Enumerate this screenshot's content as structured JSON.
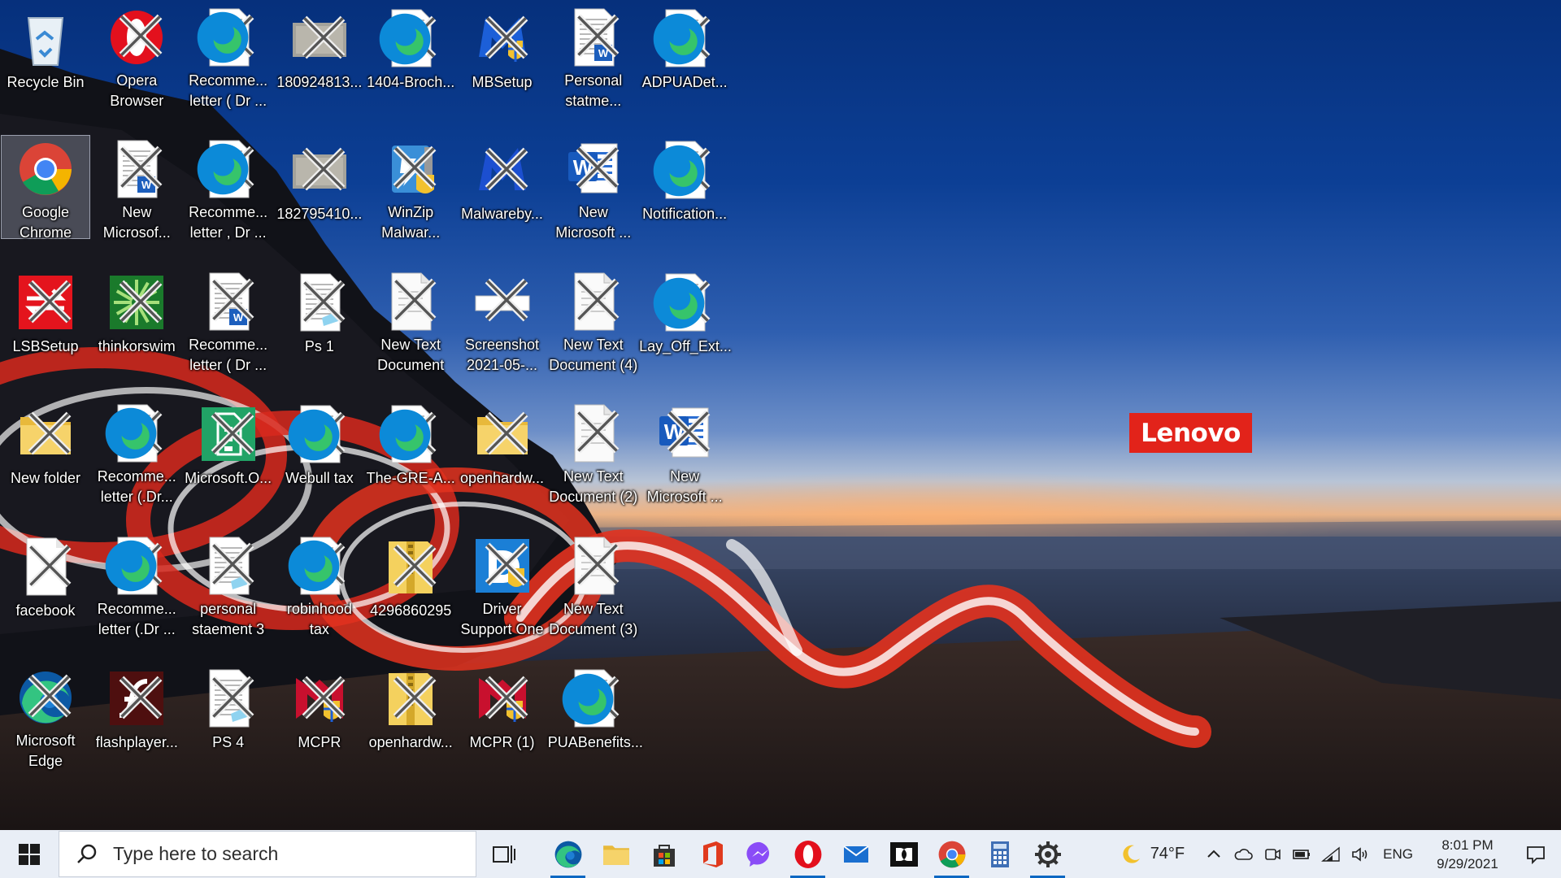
{
  "desktop": {
    "icons": [
      {
        "label": "Recycle Bin",
        "icon": "recycle-bin-icon"
      },
      {
        "label": "Opera\nBrowser",
        "icon": "opera-icon"
      },
      {
        "label": "Recomme...\nletter ( Dr ...",
        "icon": "edge-document-icon"
      },
      {
        "label": "180924813...",
        "icon": "image-thumbnail-icon"
      },
      {
        "label": "1404-Broch...",
        "icon": "edge-document-icon"
      },
      {
        "label": "MBSetup",
        "icon": "malwarebytes-setup-icon"
      },
      {
        "label": "Personal\nstatme...",
        "icon": "word-document-icon"
      },
      {
        "label": "ADPUADet...",
        "icon": "edge-document-icon"
      },
      {
        "label": "Google\nChrome",
        "icon": "chrome-icon"
      },
      {
        "label": "New\nMicrosof...",
        "icon": "word-document-icon"
      },
      {
        "label": "Recomme...\nletter , Dr ...",
        "icon": "edge-document-icon"
      },
      {
        "label": "182795410...",
        "icon": "image-thumbnail-icon"
      },
      {
        "label": "WinZip\nMalwar...",
        "icon": "winzip-icon"
      },
      {
        "label": "Malwareby...",
        "icon": "malwarebytes-icon"
      },
      {
        "label": "New\nMicrosoft ...",
        "icon": "word-icon"
      },
      {
        "label": "Notification...",
        "icon": "edge-document-icon"
      },
      {
        "label": "LSBSetup",
        "icon": "lsb-setup-icon"
      },
      {
        "label": "thinkorswim",
        "icon": "thinkorswim-icon"
      },
      {
        "label": "Recomme...\nletter ( Dr ...",
        "icon": "word-document-icon"
      },
      {
        "label": "Ps 1",
        "icon": "notepad-document-icon"
      },
      {
        "label": "New Text\nDocument",
        "icon": "text-document-icon"
      },
      {
        "label": "Screenshot\n2021-05-...",
        "icon": "screenshot-thumbnail-icon"
      },
      {
        "label": "New Text\nDocument (4)",
        "icon": "text-document-icon"
      },
      {
        "label": "Lay_Off_Ext...",
        "icon": "edge-document-icon"
      },
      {
        "label": "New folder",
        "icon": "folder-icon"
      },
      {
        "label": "Recomme...\nletter (.Dr...",
        "icon": "edge-document-icon"
      },
      {
        "label": "Microsoft.O...",
        "icon": "excel-setup-icon"
      },
      {
        "label": "Webull tax",
        "icon": "edge-document-icon"
      },
      {
        "label": "The-GRE-A...",
        "icon": "edge-document-icon"
      },
      {
        "label": "openhardw...",
        "icon": "folder-icon"
      },
      {
        "label": "New Text\nDocument (2)",
        "icon": "text-document-icon"
      },
      {
        "label": "New\nMicrosoft ...",
        "icon": "word-icon"
      },
      {
        "label": "facebook",
        "icon": "blank-file-icon"
      },
      {
        "label": "Recomme...\nletter (.Dr ...",
        "icon": "edge-document-icon"
      },
      {
        "label": "personal\nstaement 3",
        "icon": "notepad-document-icon"
      },
      {
        "label": "robinhood\ntax",
        "icon": "edge-document-icon"
      },
      {
        "label": "4296860295",
        "icon": "zip-folder-icon"
      },
      {
        "label": "Driver\nSupport One",
        "icon": "driver-support-icon"
      },
      {
        "label": "New Text\nDocument (3)",
        "icon": "text-document-icon"
      },
      {
        "label": "Microsoft\nEdge",
        "icon": "edge-icon"
      },
      {
        "label": "flashplayer...",
        "icon": "flash-player-icon"
      },
      {
        "label": "PS 4",
        "icon": "notepad-document-icon"
      },
      {
        "label": "MCPR",
        "icon": "mcafee-icon"
      },
      {
        "label": "openhardw...",
        "icon": "zip-folder-icon"
      },
      {
        "label": "MCPR (1)",
        "icon": "mcafee-icon"
      },
      {
        "label": "PUABenefits...",
        "icon": "edge-document-icon"
      }
    ]
  },
  "wallpaper": {
    "brand_label": "Lenovo",
    "brand_color": "#e2231a"
  },
  "taskbar": {
    "search_placeholder": "Type here to search",
    "apps": [
      {
        "name": "task-view",
        "icon": "task-view-icon",
        "active": false
      },
      {
        "name": "edge",
        "icon": "edge-icon",
        "active": true
      },
      {
        "name": "file-explorer",
        "icon": "folder-icon",
        "active": false
      },
      {
        "name": "microsoft-store",
        "icon": "store-icon",
        "active": false
      },
      {
        "name": "office",
        "icon": "office-icon",
        "active": false
      },
      {
        "name": "messenger",
        "icon": "messenger-icon",
        "active": false
      },
      {
        "name": "opera",
        "icon": "opera-icon",
        "active": true
      },
      {
        "name": "mail",
        "icon": "mail-icon",
        "active": false
      },
      {
        "name": "dolby",
        "icon": "dolby-icon",
        "active": false
      },
      {
        "name": "chrome",
        "icon": "chrome-icon",
        "active": true
      },
      {
        "name": "calculator",
        "icon": "calculator-icon",
        "active": false
      },
      {
        "name": "settings",
        "icon": "gear-icon",
        "active": true
      }
    ],
    "weather_temp": "74°F",
    "language": "ENG",
    "time": "8:01 PM",
    "date": "9/29/2021"
  },
  "colors": {
    "taskbar_bg": "#e9eef6",
    "accent": "#0b67c2"
  }
}
